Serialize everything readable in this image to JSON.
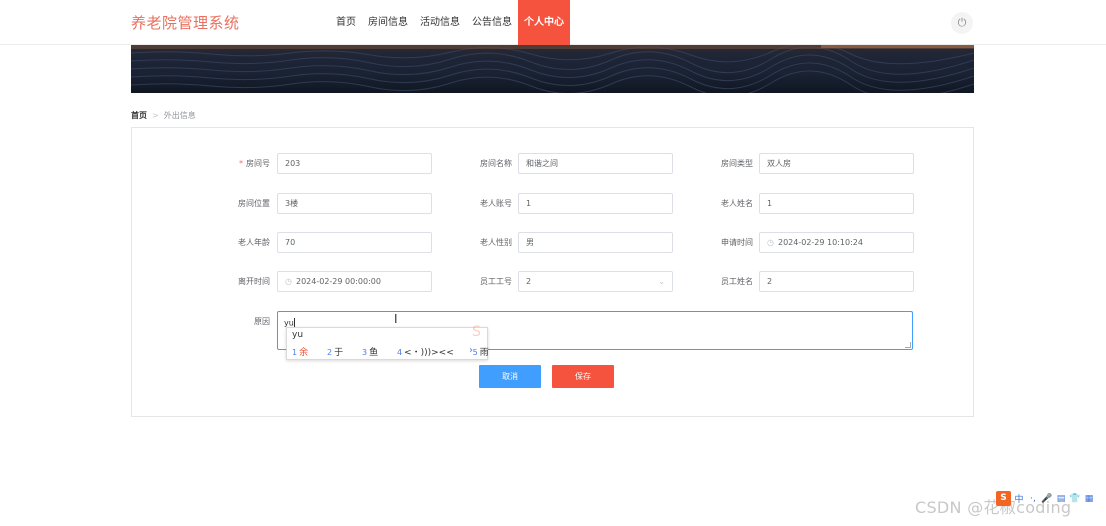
{
  "header": {
    "brand": "养老院管理系统",
    "nav": [
      "首页",
      "房间信息",
      "活动信息",
      "公告信息",
      "个人中心"
    ],
    "active_nav": "个人中心",
    "power_icon": "⏻"
  },
  "breadcrumb": {
    "home": "首页",
    "separator": ">",
    "current": "外出信息"
  },
  "form": {
    "room_no": {
      "label": "房间号",
      "value": "203",
      "required": true
    },
    "room_name": {
      "label": "房间名称",
      "value": "和谐之间"
    },
    "room_type": {
      "label": "房间类型",
      "value": "双人房"
    },
    "room_location": {
      "label": "房间位置",
      "value": "3楼"
    },
    "elder_account": {
      "label": "老人账号",
      "value": "1"
    },
    "elder_name": {
      "label": "老人姓名",
      "value": "1"
    },
    "elder_age": {
      "label": "老人年龄",
      "value": "70"
    },
    "elder_gender": {
      "label": "老人性别",
      "value": "男"
    },
    "apply_time": {
      "label": "申请时间",
      "value": "2024-02-29 10:10:24"
    },
    "leave_time": {
      "label": "离开时间",
      "value": "2024-02-29 00:00:00"
    },
    "staff_no": {
      "label": "员工工号",
      "value": "2"
    },
    "staff_name": {
      "label": "员工姓名",
      "value": "2"
    },
    "reason": {
      "label": "原因",
      "value": "yu"
    }
  },
  "ime": {
    "composition": "yu",
    "candidates": [
      {
        "n": "1",
        "text": "余"
      },
      {
        "n": "2",
        "text": "于"
      },
      {
        "n": "3",
        "text": "鱼"
      },
      {
        "n": "4",
        "text": "<・)))><<"
      },
      {
        "n": "5",
        "text": "雨"
      }
    ],
    "next": "›"
  },
  "buttons": {
    "cancel": "取消",
    "save": "保存"
  },
  "watermark": "CSDN @花椒coding",
  "tray": {
    "logo": "S",
    "items": [
      "中",
      "·,",
      "🎤",
      "▤",
      "👕",
      "▦"
    ]
  },
  "colors": {
    "brand": "#e9705f",
    "accent": "#f5533d",
    "primary": "#409eff"
  }
}
